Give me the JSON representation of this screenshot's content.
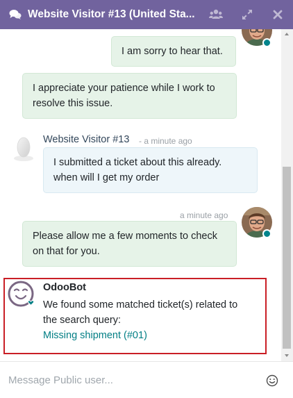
{
  "header": {
    "title": "Website Visitor #13 (United Sta...",
    "icons": [
      "comments-icon",
      "users-icon",
      "expand-icon",
      "close-icon"
    ],
    "color": "#71639e"
  },
  "messages": [
    {
      "text": "I am sorry to hear that."
    },
    {
      "text": "I appreciate your patience while I work to resolve this issue."
    },
    {
      "author": "Website Visitor #13",
      "time": "- a minute ago",
      "text": "I submitted a ticket about this already. when will I get my order"
    },
    {
      "time": "a minute ago",
      "text": "Please allow me a few moments to check on that for you."
    }
  ],
  "bot_message": {
    "author": "OdooBot",
    "text": "We found some matched ticket(s) related to the search query:",
    "link": "Missing shipment (#01)"
  },
  "composer": {
    "placeholder": "Message Public user...",
    "emoji_icon": "smile-icon"
  },
  "colors": {
    "accent": "#71639e",
    "link": "#017e84",
    "highlight_border": "#c91e25",
    "agent_bubble": "#e6f3e8",
    "visitor_bubble": "#eef6fa"
  }
}
